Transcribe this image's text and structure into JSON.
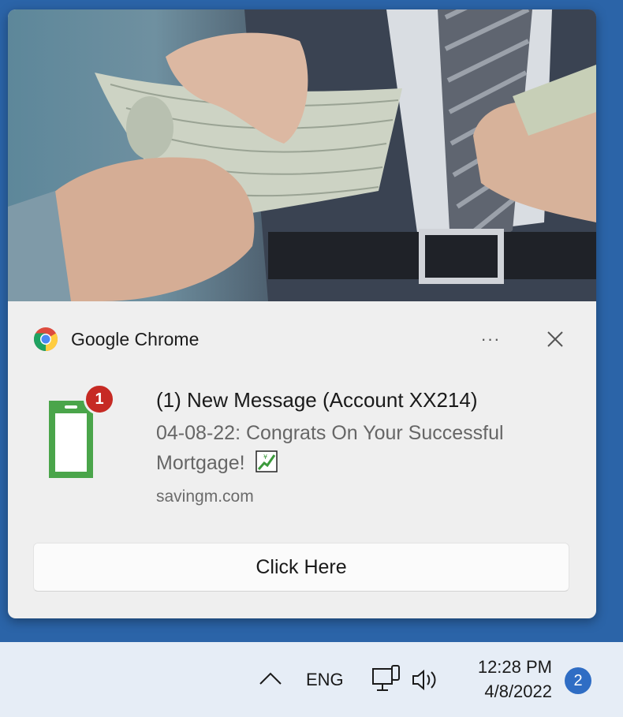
{
  "notification": {
    "app_name": "Google Chrome",
    "title": "(1) New Message (Account XX214)",
    "body": "04-08-22: Congrats On Your Successful Mortgage!",
    "source": "savingm.com",
    "badge_count": "1",
    "more_label": "···",
    "action_label": "Click Here",
    "image_icon": "money-handover-photo",
    "icon": "green-phone-icon"
  },
  "taskbar": {
    "language": "ENG",
    "time": "12:28 PM",
    "date": "4/8/2022",
    "notification_count": "2"
  },
  "colors": {
    "desktop": "#2b64a8",
    "toast_background": "#efefef",
    "badge": "#c62a24",
    "phone_icon": "#4aa54a",
    "notification_count_bg": "#2f6dc4"
  }
}
